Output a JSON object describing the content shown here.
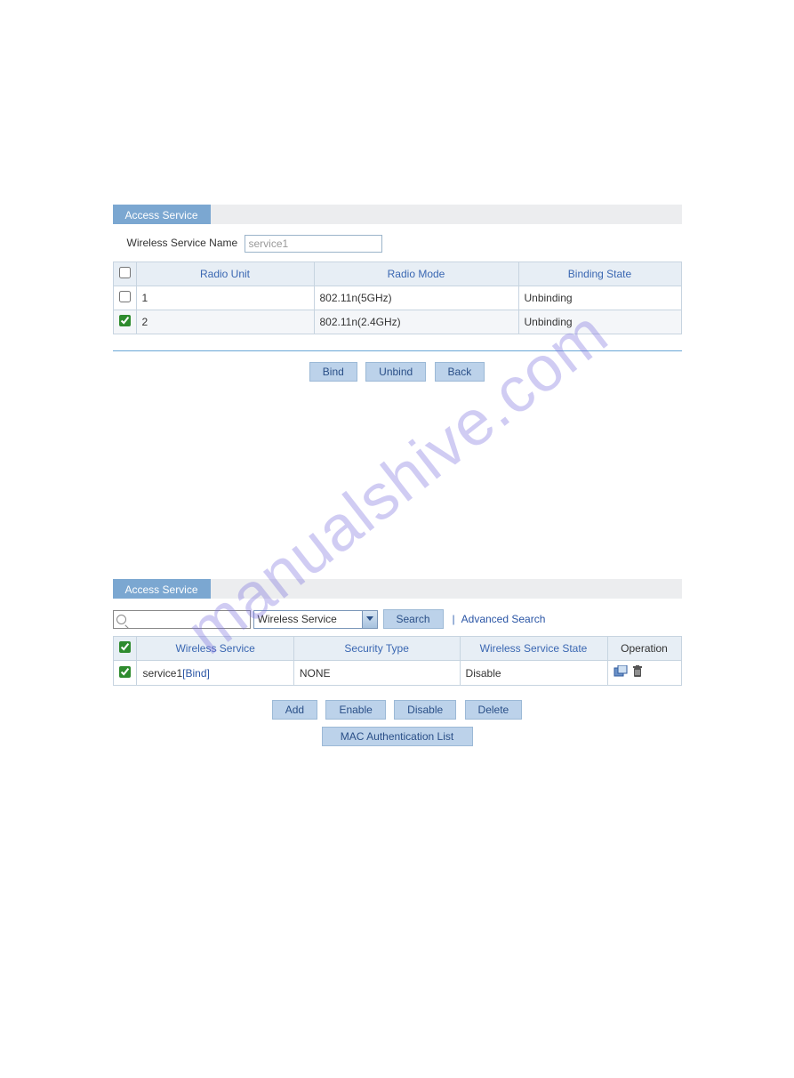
{
  "watermark": "manualshive.com",
  "upper": {
    "tab_label": "Access Service",
    "form_label": "Wireless Service Name",
    "service_name_value": "service1",
    "headers": {
      "radio_unit": "Radio Unit",
      "radio_mode": "Radio Mode",
      "binding_state": "Binding State"
    },
    "rows": [
      {
        "checked": false,
        "radio_unit": "1",
        "radio_mode": "802.11n(5GHz)",
        "binding_state": "Unbinding"
      },
      {
        "checked": true,
        "radio_unit": "2",
        "radio_mode": "802.11n(2.4GHz)",
        "binding_state": "Unbinding"
      }
    ],
    "buttons": {
      "bind": "Bind",
      "unbind": "Unbind",
      "back": "Back"
    }
  },
  "lower": {
    "tab_label": "Access Service",
    "search_dropdown": "Wireless Service",
    "search_btn": "Search",
    "advanced_search": "Advanced Search",
    "headers": {
      "wireless_service": "Wireless Service",
      "security_type": "Security Type",
      "service_state": "Wireless Service State",
      "operation": "Operation"
    },
    "rows": [
      {
        "checked": true,
        "service_name": "service1",
        "bind_link": "[Bind]",
        "security_type": "NONE",
        "service_state": "Disable"
      }
    ],
    "buttons": {
      "add": "Add",
      "enable": "Enable",
      "disable": "Disable",
      "delete": "Delete",
      "mac_auth": "MAC Authentication List"
    }
  }
}
